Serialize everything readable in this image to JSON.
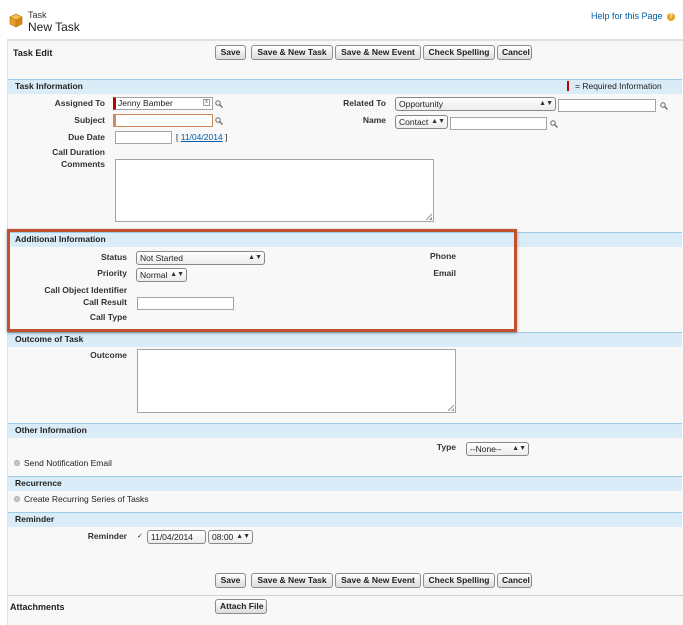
{
  "header": {
    "object_label": "Task",
    "title": "New Task",
    "help_link": "Help for this Page"
  },
  "buttons": {
    "save": "Save",
    "save_new_task": "Save & New Task",
    "save_new_event": "Save & New Event",
    "check_spelling": "Check Spelling",
    "cancel": "Cancel"
  },
  "edit_title": "Task Edit",
  "task_info": {
    "header": "Task Information",
    "required_note": "= Required Information",
    "assigned_to_label": "Assigned To",
    "assigned_to_value": "Jenny Bamber",
    "subject_label": "Subject",
    "subject_value": "",
    "due_date_label": "Due Date",
    "due_date_value": "",
    "due_date_link": "11/04/2014",
    "call_duration_label": "Call Duration",
    "comments_label": "Comments",
    "related_to_label": "Related To",
    "related_to_value": "Opportunity",
    "name_label": "Name",
    "name_type": "Contact"
  },
  "additional_info": {
    "header": "Additional Information",
    "status_label": "Status",
    "status_value": "Not Started",
    "priority_label": "Priority",
    "priority_value": "Normal",
    "call_object_label": "Call Object Identifier",
    "call_result_label": "Call Result",
    "call_type_label": "Call Type",
    "phone_label": "Phone",
    "email_label": "Email"
  },
  "outcome": {
    "header": "Outcome of Task",
    "outcome_label": "Outcome"
  },
  "other_info": {
    "header": "Other Information",
    "type_label": "Type",
    "type_value": "--None--",
    "send_notification": "Send Notification Email"
  },
  "recurrence": {
    "header": "Recurrence",
    "create_recurring": "Create Recurring Series of Tasks"
  },
  "reminder": {
    "header": "Reminder",
    "label": "Reminder",
    "date": "11/04/2014",
    "time": "08:00",
    "checked": true
  },
  "attachments": {
    "header": "Attachments",
    "attach_button": "Attach File"
  },
  "colors": {
    "highlight_border": "#c0502e",
    "section_bg": "#d9ecf7",
    "required": "#c00000",
    "link": "#015ba7"
  }
}
